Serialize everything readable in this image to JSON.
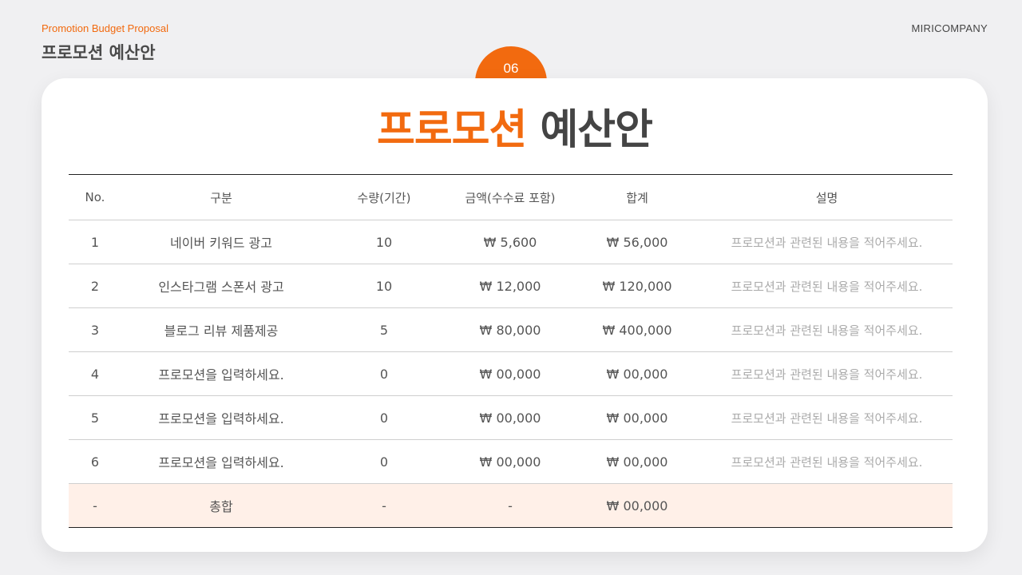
{
  "header": {
    "subtitle": "Promotion Budget Proposal",
    "title": "프로모션 예산안",
    "company": "MIRICOMPANY",
    "page_number": "06"
  },
  "main_title": {
    "accent": "프로모션",
    "rest": "예산안"
  },
  "table": {
    "headers": [
      "No.",
      "구분",
      "수량(기간)",
      "금액(수수료 포함)",
      "합계",
      "설명"
    ],
    "rows": [
      [
        "1",
        "네이버 키워드 광고",
        "10",
        "₩ 5,600",
        "₩ 56,000",
        "프로모션과 관련된 내용을 적어주세요."
      ],
      [
        "2",
        "인스타그램 스폰서 광고",
        "10",
        "₩ 12,000",
        "₩ 120,000",
        "프로모션과 관련된 내용을 적어주세요."
      ],
      [
        "3",
        "블로그 리뷰 제품제공",
        "5",
        "₩ 80,000",
        "₩ 400,000",
        "프로모션과 관련된 내용을 적어주세요."
      ],
      [
        "4",
        "프로모션을 입력하세요.",
        "0",
        "₩ 00,000",
        "₩ 00,000",
        "프로모션과 관련된 내용을 적어주세요."
      ],
      [
        "5",
        "프로모션을 입력하세요.",
        "0",
        "₩ 00,000",
        "₩ 00,000",
        "프로모션과 관련된 내용을 적어주세요."
      ],
      [
        "6",
        "프로모션을 입력하세요.",
        "0",
        "₩ 00,000",
        "₩ 00,000",
        "프로모션과 관련된 내용을 적어주세요."
      ]
    ],
    "total": [
      "-",
      "총합",
      "-",
      "-",
      "₩ 00,000",
      ""
    ]
  },
  "colors": {
    "accent": "#f26a0f",
    "total_row_bg": "#fff0e8"
  }
}
